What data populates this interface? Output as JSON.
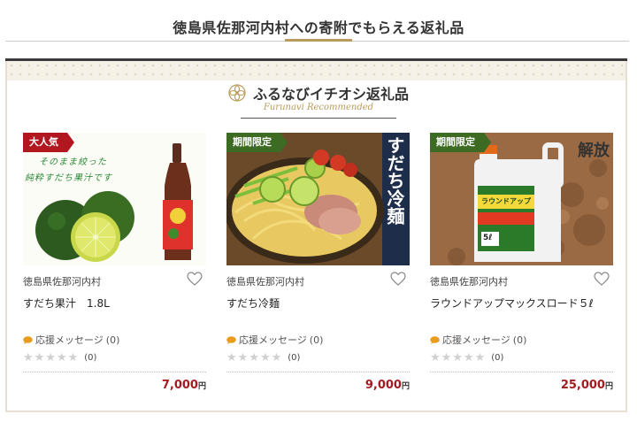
{
  "page": {
    "title": "徳島県佐那河内村への寄附でもらえる返礼品"
  },
  "section": {
    "title": "ふるなびイチオシ返礼品",
    "subtitle": "Furunavi Recommended"
  },
  "cards": [
    {
      "badge": "大人気",
      "image_text": [
        "そのまま絞った",
        "純粋すだち果汁です"
      ],
      "municipality": "徳島県佐那河内村",
      "name": "すだち果汁　1.8L",
      "message_label": "応援メッセージ",
      "message_count": "(0)",
      "review_count": "(0)",
      "price": "7,000",
      "currency": "円"
    },
    {
      "badge": "期間限定",
      "image_text": [
        "すだち冷麺"
      ],
      "municipality": "徳島県佐那河内村",
      "name": "すだち冷麺",
      "message_label": "応援メッセージ",
      "message_count": "(0)",
      "review_count": "(0)",
      "price": "9,000",
      "currency": "円"
    },
    {
      "badge": "期間限定",
      "image_text": [
        "解放",
        "ラウンドアップ",
        "5ℓ"
      ],
      "municipality": "徳島県佐那河内村",
      "name": "ラウンドアップマックスロード５ℓ",
      "message_label": "応援メッセージ",
      "message_count": "(0)",
      "review_count": "(0)",
      "price": "25,000",
      "currency": "円"
    }
  ],
  "colors": {
    "accent_gold": "#b99a5c",
    "price_red": "#a31c22",
    "badge_red": "#b2161e",
    "badge_green": "#3d6b24"
  },
  "icons": {
    "heart": "heart-icon",
    "bubble": "speech-bubble-icon",
    "star": "star-icon",
    "flower": "kamon-flower-icon"
  }
}
